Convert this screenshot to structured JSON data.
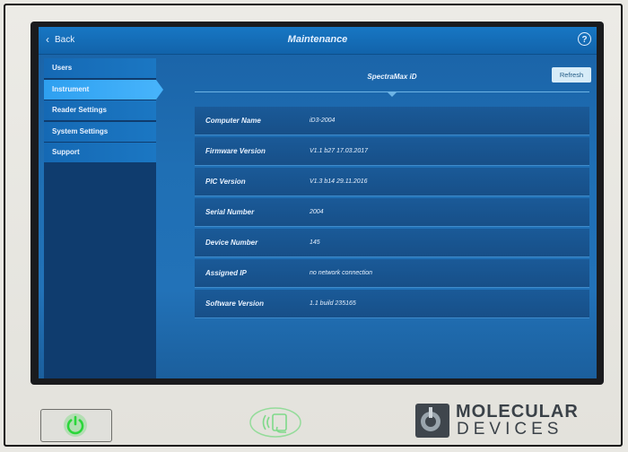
{
  "header": {
    "back_label": "Back",
    "title": "Maintenance",
    "help_symbol": "?"
  },
  "sidebar": {
    "items": [
      {
        "label": "Users",
        "active": false
      },
      {
        "label": "Instrument",
        "active": true
      },
      {
        "label": "Reader Settings",
        "active": false
      },
      {
        "label": "System Settings",
        "active": false
      },
      {
        "label": "Support",
        "active": false
      }
    ]
  },
  "main": {
    "device_name": "SpectraMax iD",
    "refresh_label": "Refresh",
    "rows": [
      {
        "label": "Computer Name",
        "value": "iD3-2004"
      },
      {
        "label": "Firmware Version",
        "value": "V1.1 b27 17.03.2017"
      },
      {
        "label": "PIC Version",
        "value": "V1.3 b14 29.11.2016"
      },
      {
        "label": "Serial Number",
        "value": "2004"
      },
      {
        "label": "Device Number",
        "value": "145"
      },
      {
        "label": "Assigned IP",
        "value": "no network connection"
      },
      {
        "label": "Software Version",
        "value": "1.1 build 235165"
      }
    ]
  },
  "hardware": {
    "power_icon": "power-icon",
    "nfc_icon": "nfc-reader-icon"
  },
  "brand": {
    "line1": "MOLECULAR",
    "line2": "DEVICES"
  },
  "colors": {
    "screen_blue": "#1f6fb4",
    "sidebar_active": "#46b3fb",
    "power_green": "#2bd63a",
    "nfc_green": "#7fd98a"
  }
}
